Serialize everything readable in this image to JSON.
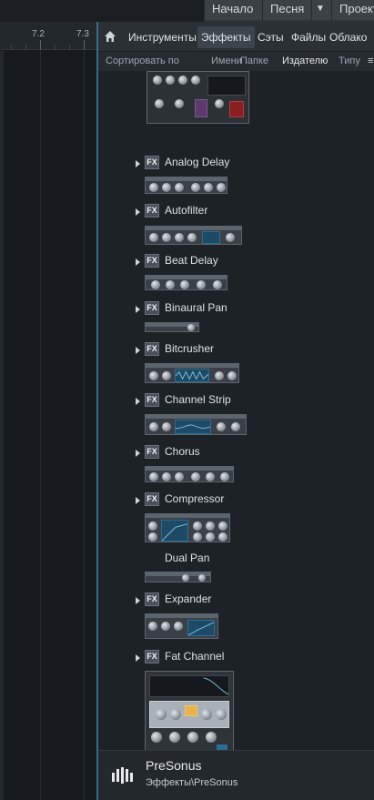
{
  "topbar": {
    "start_label": "Начало",
    "song_label": "Песня",
    "project_label": "Проект"
  },
  "ruler": {
    "ticks": [
      "7.2",
      "7.3"
    ]
  },
  "browser": {
    "tabs": [
      {
        "label": "Инструменты"
      },
      {
        "label": "Эффекты"
      },
      {
        "label": "Сэты"
      },
      {
        "label": "Файлы"
      },
      {
        "label": "Облако"
      }
    ],
    "active_tab": "Эффекты",
    "sort": {
      "prefix": "Сортировать по",
      "options": [
        "Имени",
        "Папке",
        "Издателю",
        "Типу"
      ],
      "selected": "Издателю"
    },
    "items": [
      {
        "label": "Analog Delay",
        "badge": "FX",
        "expandable": true
      },
      {
        "label": "Autofilter",
        "badge": "FX",
        "expandable": true
      },
      {
        "label": "Beat Delay",
        "badge": "FX",
        "expandable": true
      },
      {
        "label": "Binaural Pan",
        "badge": "FX",
        "expandable": true
      },
      {
        "label": "Bitcrusher",
        "badge": "FX",
        "expandable": true
      },
      {
        "label": "Channel Strip",
        "badge": "FX",
        "expandable": true
      },
      {
        "label": "Chorus",
        "badge": "FX",
        "expandable": true
      },
      {
        "label": "Compressor",
        "badge": "FX",
        "expandable": true
      },
      {
        "label": "Dual Pan",
        "badge": "",
        "expandable": false
      },
      {
        "label": "Expander",
        "badge": "FX",
        "expandable": true
      },
      {
        "label": "Fat Channel",
        "badge": "FX",
        "expandable": true
      }
    ],
    "footer": {
      "title": "PreSonus",
      "path": "Эффекты\\PreSonus"
    }
  },
  "colors": {
    "accent": "#3b6a8a",
    "panel": "#1d2227",
    "tab_active": "#3d444b"
  }
}
